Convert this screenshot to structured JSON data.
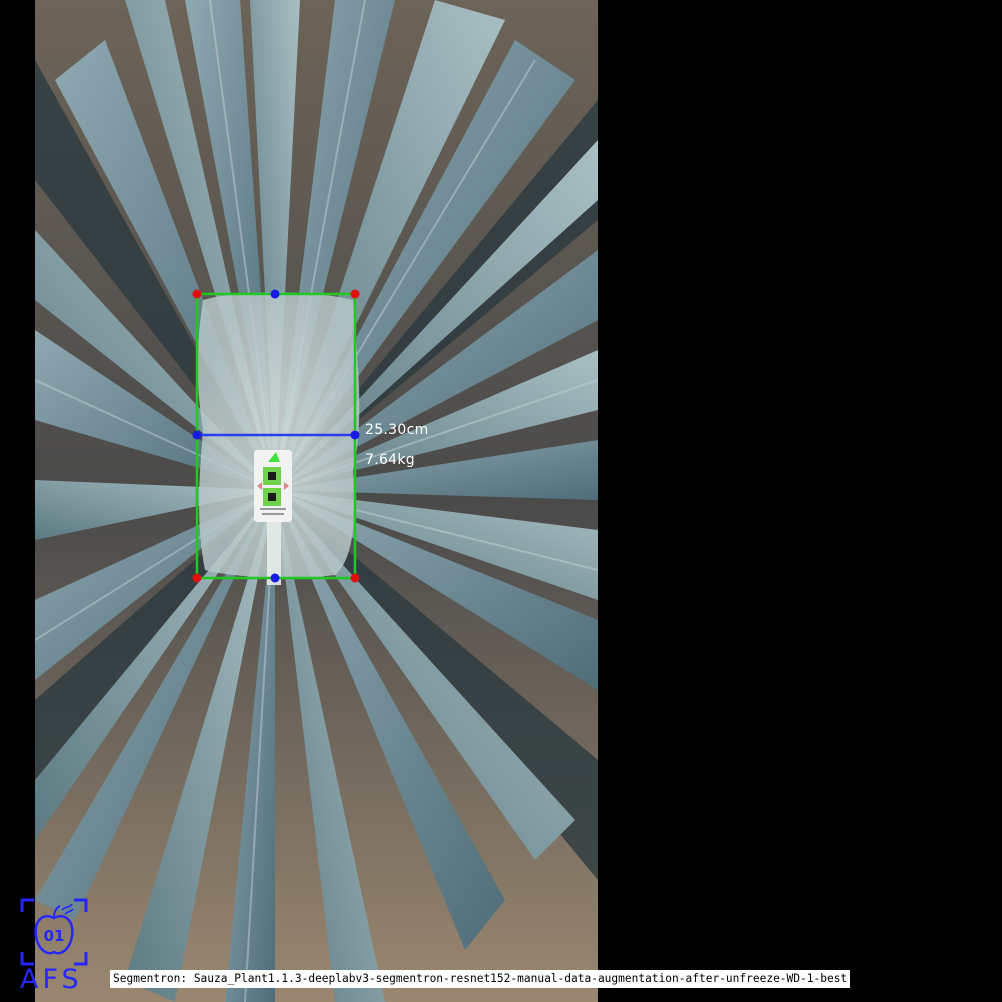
{
  "photo": {
    "subject": "agave-plant-top-view",
    "background_color": "#000000"
  },
  "detection": {
    "box_color": "#22c822",
    "corner_color": "#e01010",
    "midpoint_color": "#1a1ae6",
    "width_line_color": "#2a3cf0",
    "width_label": "25.30cm",
    "weight_label": "7.64kg"
  },
  "logo": {
    "icon": "apple-camera-icon",
    "number": "01",
    "text": "AFS",
    "color": "#2626ff"
  },
  "caption": {
    "text": "Segmentron: Sauza_Plant1.1.3-deeplabv3-segmentron-resnet152-manual-data-augmentation-after-unfreeze-WD-1-best"
  }
}
